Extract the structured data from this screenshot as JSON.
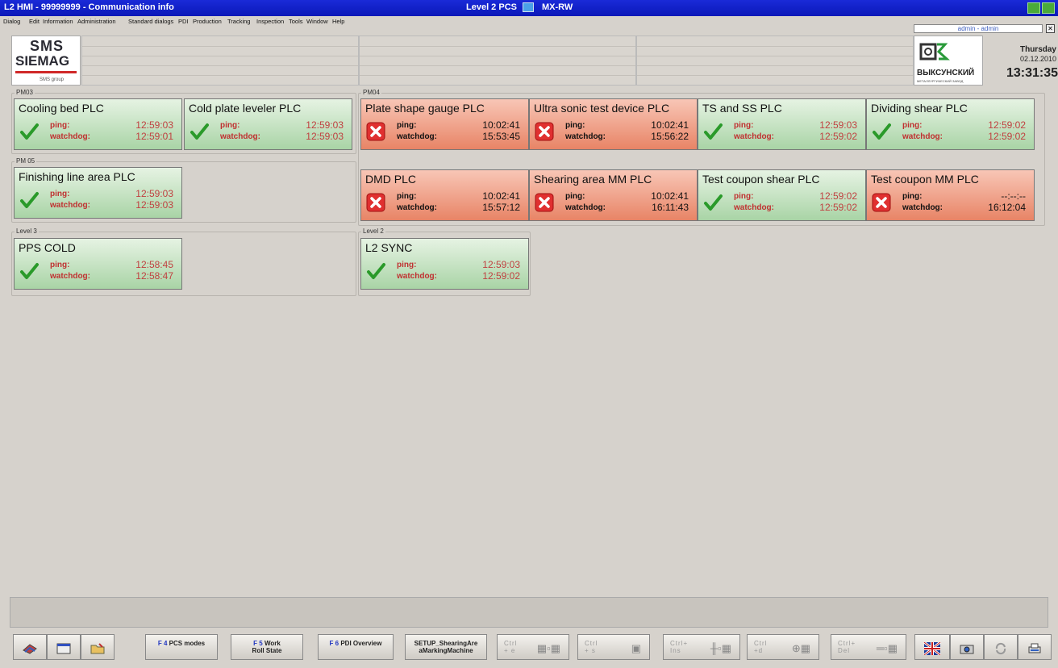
{
  "window": {
    "title": "L2 HMI - 99999999 - Communication info",
    "center_label": "Level 2 PCS",
    "mode": "MX-RW"
  },
  "menu": [
    "Dialog",
    "Edit",
    "Information",
    "Administration",
    "Standard dialogs",
    "PDI",
    "Production",
    "Tracking",
    "Inspection",
    "Tools",
    "Window",
    "Help"
  ],
  "user": "admin - admin",
  "logo": {
    "line1": "SMS",
    "line2": "SIEMAG",
    "line3": "SMS group"
  },
  "customer": {
    "name": "ВЫКСУНСКИЙ",
    "sub": "МЕТАЛЛУРГИЧЕСКИЙ ЗАВОД"
  },
  "clock": {
    "day": "Thursday",
    "date": "02.12.2010",
    "time": "13:31:35"
  },
  "labels": {
    "ping": "ping:",
    "watchdog": "watchdog:"
  },
  "groups": {
    "pm03": "PM03",
    "pm04": "PM04",
    "pm05": "PM 05",
    "level3": "Level 3",
    "level2": "Level 2"
  },
  "cards": {
    "cooling_bed": {
      "title": "Cooling bed PLC",
      "status": "ok",
      "ping": "12:59:03",
      "watchdog": "12:59:01"
    },
    "cold_plate": {
      "title": "Cold plate leveler PLC",
      "status": "ok",
      "ping": "12:59:03",
      "watchdog": "12:59:03"
    },
    "finishing": {
      "title": "Finishing line area PLC",
      "status": "ok",
      "ping": "12:59:03",
      "watchdog": "12:59:03"
    },
    "pps_cold": {
      "title": "PPS COLD",
      "status": "ok",
      "ping": "12:58:45",
      "watchdog": "12:58:47"
    },
    "plate_shape": {
      "title": "Plate shape gauge PLC",
      "status": "err",
      "ping": "10:02:41",
      "watchdog": "15:53:45"
    },
    "ultra_sonic": {
      "title": "Ultra sonic test device PLC",
      "status": "err",
      "ping": "10:02:41",
      "watchdog": "15:56:22"
    },
    "ts_ss": {
      "title": "TS and SS PLC",
      "status": "ok",
      "ping": "12:59:03",
      "watchdog": "12:59:02"
    },
    "dividing_shear": {
      "title": "Dividing shear PLC",
      "status": "ok",
      "ping": "12:59:02",
      "watchdog": "12:59:02"
    },
    "dmd": {
      "title": "DMD PLC",
      "status": "err",
      "ping": "10:02:41",
      "watchdog": "15:57:12"
    },
    "shearing_mm": {
      "title": "Shearing area MM PLC",
      "status": "err",
      "ping": "10:02:41",
      "watchdog": "16:11:43"
    },
    "coupon_shear": {
      "title": "Test coupon shear PLC",
      "status": "ok",
      "ping": "12:59:02",
      "watchdog": "12:59:02"
    },
    "coupon_mm": {
      "title": "Test coupon MM PLC",
      "status": "err",
      "ping": "--:--:--",
      "watchdog": "16:12:04"
    },
    "l2_sync": {
      "title": "L2 SYNC",
      "status": "ok",
      "ping": "12:59:03",
      "watchdog": "12:59:02"
    }
  },
  "toolbar": {
    "f4_key": "F 4",
    "f4_label": "PCS modes",
    "f5_key": "F 5",
    "f5_label1": "Work",
    "f5_label2": "Roll State",
    "f6_key": "F 6",
    "f6_label": "PDI Overview",
    "f7_key": "SETUP",
    "f7_label1": "SETUP_ShearingAre",
    "f7_label2": "aMarkingMachine",
    "ctrl_e": "Ctrl\n+ e",
    "ctrl_s": "Ctrl\n+ s",
    "ctrl_ins": "Ctrl+\nIns",
    "ctrl_d": "Ctrl\n+d",
    "ctrl_del": "Ctrl+\nDel"
  }
}
